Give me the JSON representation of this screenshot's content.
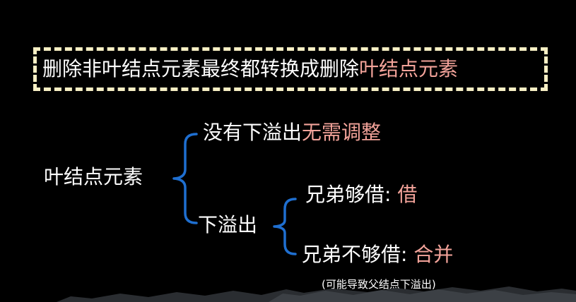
{
  "title": {
    "prefix": "删除非叶结点元素最终都转换成删除",
    "highlight": "叶结点元素"
  },
  "root": {
    "label": "叶结点元素"
  },
  "no_overflow": {
    "label": "没有下溢出",
    "action": "无需调整"
  },
  "underflow": {
    "label": "下溢出",
    "borrow": {
      "label": "兄弟够借: ",
      "action": "借"
    },
    "merge": {
      "label": "兄弟不够借: ",
      "action": "合并",
      "note": "(可能导致父结点下溢出)"
    }
  },
  "colors": {
    "background": "#000000",
    "text": "#ffffff",
    "accent": "#f3a39a",
    "bracket": "#1f6fd0",
    "dash_border": "#f7efc4"
  }
}
